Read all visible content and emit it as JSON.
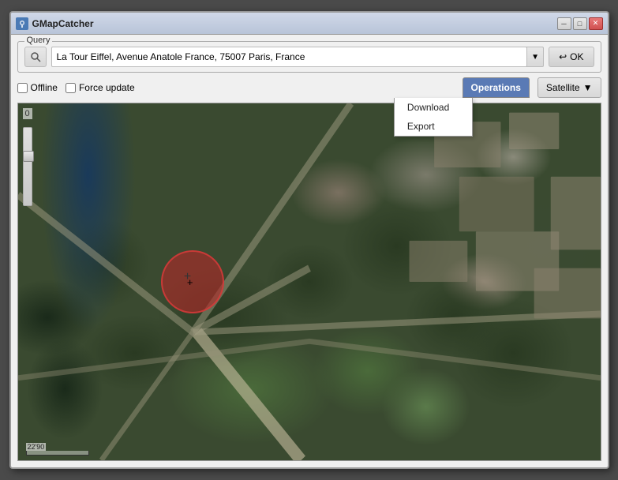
{
  "window": {
    "title": "GMapCatcher",
    "title_icon": "🗺"
  },
  "titlebar": {
    "minimize_label": "─",
    "restore_label": "□",
    "close_label": "✕"
  },
  "query": {
    "group_label": "Query",
    "search_icon": "⚙",
    "input_value": "La Tour Eiffel, Avenue Anatole France, 75007 Paris, France",
    "dropdown_arrow": "▼",
    "ok_icon": "↩",
    "ok_label": "OK"
  },
  "toolbar": {
    "offline_label": "Offline",
    "force_update_label": "Force update",
    "offline_checked": false,
    "force_update_checked": false,
    "operations_label": "Operations",
    "satellite_label": "Satellite",
    "satellite_arrow": "▼"
  },
  "dropdown": {
    "download_label": "Download",
    "export_label": "Export"
  },
  "map": {
    "zoom_label": "0"
  },
  "scale": {
    "text": "22'90"
  }
}
